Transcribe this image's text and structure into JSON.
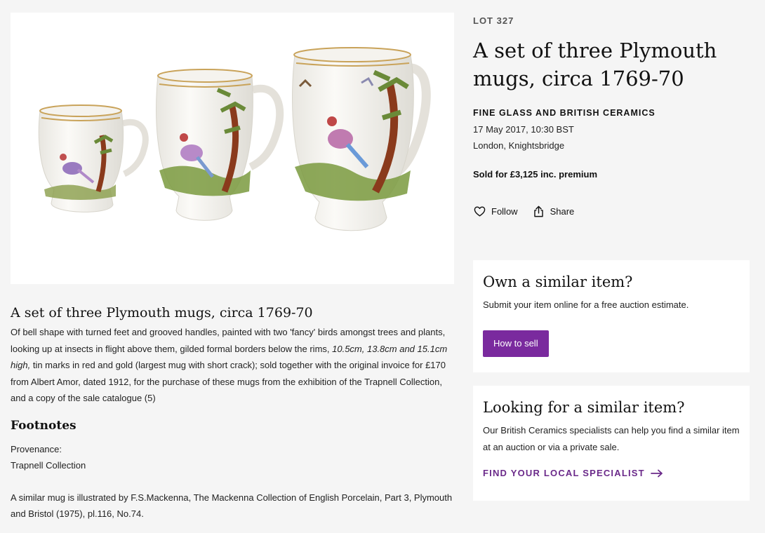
{
  "image": {
    "alt": "Three Plymouth porcelain mugs painted with birds"
  },
  "lot": {
    "label": "LOT 327",
    "title": "A set of three Plymouth mugs, circa 1769-70",
    "department": "FINE GLASS AND BRITISH CERAMICS",
    "date": "17 May 2017, 10:30 BST",
    "location": "London, Knightsbridge",
    "sold": "Sold for £3,125 inc. premium"
  },
  "actions": {
    "follow": {
      "label": "Follow",
      "icon": "heart-icon"
    },
    "share": {
      "label": "Share",
      "icon": "share-icon"
    }
  },
  "description": {
    "title": "A set of three Plymouth mugs, circa 1769-70",
    "part1": "Of bell shape with turned feet and grooved handles, painted with two 'fancy' birds amongst trees and plants, looking up at insects in flight above them, gilded formal borders below the rims, ",
    "dimensions": "10.5cm, 13.8cm and 15.1cm high,",
    "part2": " tin marks in red and gold (largest mug with short crack); sold together with the original invoice for £170 from Albert Amor, dated 1912, for the purchase of these mugs from the exhibition of the Trapnell Collection, and a copy of the sale catalogue (5)"
  },
  "footnotes": {
    "title": "Footnotes",
    "provenance_label": "Provenance:",
    "provenance_value": "Trapnell Collection",
    "note": "A similar mug is illustrated by F.S.Mackenna, The Mackenna Collection of English Porcelain, Part 3, Plymouth and Bristol (1975), pl.116, No.74."
  },
  "cards": {
    "own": {
      "title": "Own a similar item?",
      "text": "Submit your item online for a free auction estimate.",
      "button": "How to sell"
    },
    "looking": {
      "title": "Looking for a similar item?",
      "text": "Our British Ceramics specialists can help you find a similar item at an auction or via a private sale.",
      "link": "FIND YOUR LOCAL SPECIALIST"
    }
  },
  "colors": {
    "accent": "#7a2a9e",
    "link": "#6b2a8a",
    "background": "#f5f5f5"
  }
}
